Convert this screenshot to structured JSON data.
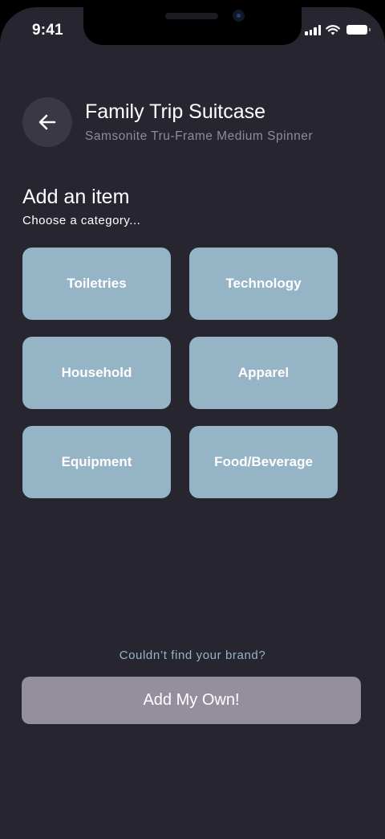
{
  "status_bar": {
    "time": "9:41"
  },
  "header": {
    "title": "Family Trip Suitcase",
    "subtitle": "Samsonite Tru-Frame Medium Spinner"
  },
  "section": {
    "heading": "Add an item",
    "subheading": "Choose a category..."
  },
  "categories": [
    "Toiletries",
    "Technology",
    "Household",
    "Apparel",
    "Equipment",
    "Food/Beverage"
  ],
  "footer": {
    "help_text": "Couldn’t find your brand?",
    "button_label": "Add My Own!"
  },
  "colors": {
    "background": "#27252f",
    "category_tile": "#95b4c6",
    "accent_text": "#95b4c6",
    "secondary_button": "#958e9d"
  }
}
